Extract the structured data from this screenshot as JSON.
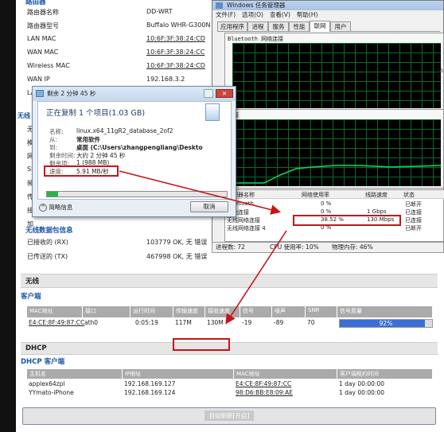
{
  "router": {
    "section_header_partial": "路由器",
    "info": [
      {
        "label": "路由器名称",
        "value": "DD-WRT"
      },
      {
        "label": "路由器型号",
        "value": "Buffalo WHR-G300N"
      },
      {
        "label": "LAN MAC",
        "value": "10:6F:3F:38:24:CD"
      },
      {
        "label": "WAN MAC",
        "value": "10:6F:3F:38:24:CC"
      },
      {
        "label": "Wireless MAC",
        "value": "10:6F:3F:38:24:CD"
      },
      {
        "label": "WAN IP",
        "value": "192.168.3.2"
      },
      {
        "label": "LA",
        "value": ""
      }
    ],
    "left_cut_labels": [
      "无线",
      "无",
      "模",
      "网",
      "SS",
      "频",
      "传",
      "接",
      "加"
    ],
    "packet_section": {
      "title": "无线数据包信息",
      "rows": [
        {
          "label": "已接收的 (RX)",
          "value": "103779 OK, 无 错误"
        },
        {
          "label": "已传送的 (TX)",
          "value": "467998 OK, 无 错误"
        }
      ]
    },
    "wireless": {
      "header": "无线",
      "client_title": "客户端",
      "columns": [
        "MAC地址",
        "接口",
        "运行时间",
        "传输速度",
        "接收速度",
        "信号",
        "噪声",
        "SNR",
        "信号质量"
      ],
      "row": {
        "mac": "E4:CE:8F:49:87:CC",
        "iface": "ath0",
        "uptime": "0:05:19",
        "tx": "117M",
        "rx": "130M",
        "signal": "-19",
        "noise": "-89",
        "snr": "70",
        "quality": "92%",
        "quality_value": 92
      }
    },
    "dhcp": {
      "header": "DHCP",
      "client_title": "DHCP 客户端",
      "columns": [
        "主机名",
        "IP地址",
        "MAC地址",
        "客户端租约时间"
      ],
      "rows": [
        {
          "host": "applex64zpl",
          "ip": "192.168.169.127",
          "mac": "E4:CE:8F:49:87:CC",
          "lease": "1 day 00:00:00"
        },
        {
          "host": "YYmato-iPhone",
          "ip": "192.168.169.124",
          "mac": "98:D6:BB:E8:09:AE",
          "lease": "1 day 00:00:00"
        }
      ]
    },
    "auto_refresh_label": "自动刷新[开启]"
  },
  "task_manager": {
    "title": "Windows 任务管理器",
    "menu": [
      "文件(F)",
      "选项(O)",
      "查看(V)",
      "帮助(H)"
    ],
    "tabs": [
      "应用程序",
      "进程",
      "服务",
      "性能",
      "联网",
      "用户"
    ],
    "active_tab": "联网",
    "graph1_label": "Bluetooth 网络连接",
    "graph2_label": "连接",
    "graph_pct": [
      "50 %",
      "0 %"
    ],
    "columns": [
      "适配器名称",
      "网络使用率",
      "线路速度",
      "状态"
    ],
    "rows": [
      {
        "name": "Bluetooth",
        "usage": "0 %",
        "speed": "",
        "status": "已断开"
      },
      {
        "name": "本地连接",
        "usage": "0 %",
        "speed": "1 Gbps",
        "status": "已连接"
      },
      {
        "name": "无线网络连接",
        "usage": "38.52 %",
        "speed": "130 Mbps",
        "status": "已连接"
      },
      {
        "name": "无线网络连接 4",
        "usage": "0 %",
        "speed": "",
        "status": "已断开"
      }
    ],
    "status_bar": {
      "processes": "进程数: 72",
      "cpu": "CPU 使用率: 10%",
      "memory": "物理内存: 46%"
    }
  },
  "copy_dialog": {
    "title": "剩余 2 分钟 45 秒",
    "heading": "正在复制 1 个项目(1.03 GB)",
    "fields": [
      {
        "label": "名称:",
        "value": "linux.x64_11gR2_database_2of2"
      },
      {
        "label": "从:",
        "value": "常用软件"
      },
      {
        "label": "到:",
        "value": "桌面 (C:\\Users\\zhangpengliang\\Deskto"
      },
      {
        "label": "剩余时间:",
        "value": "大约 2 分钟 45 秒"
      },
      {
        "label": "剩余项:",
        "value": "1 (988 MB)"
      },
      {
        "label": "速度:",
        "value": "5.91 MB/秒"
      }
    ],
    "progress": 0.06,
    "details_label": "简略信息",
    "cancel_label": "取消"
  },
  "colors": {
    "accent_red": "#c8141a",
    "graph_green": "#00e35a",
    "quality_blue": "#3b6fd8"
  }
}
